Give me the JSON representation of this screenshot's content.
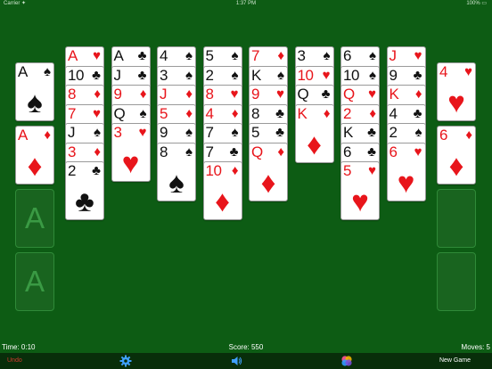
{
  "status_bar": {
    "carrier": "Carrier ✦",
    "clock": "1:37 PM",
    "battery": "100% ▭"
  },
  "colors": {
    "felt": "#0d5c14",
    "red_suit": "#e8151b",
    "black_suit": "#111111",
    "undo": "#d23a2e"
  },
  "free_cells": [
    {
      "rank": "A",
      "suit": "♠",
      "color": "black"
    },
    {
      "rank": "A",
      "suit": "♦",
      "color": "red"
    },
    {
      "empty": true,
      "glyph": "A"
    },
    {
      "empty": true,
      "glyph": "A"
    }
  ],
  "foundations": [
    {
      "rank": "4",
      "suit": "♥",
      "color": "red"
    },
    {
      "rank": "6",
      "suit": "♦",
      "color": "red"
    },
    {
      "empty": true
    },
    {
      "empty": true
    }
  ],
  "tableau": [
    [
      {
        "rank": "A",
        "suit": "♥",
        "color": "red"
      },
      {
        "rank": "10",
        "suit": "♣",
        "color": "black"
      },
      {
        "rank": "8",
        "suit": "♦",
        "color": "red"
      },
      {
        "rank": "7",
        "suit": "♥",
        "color": "red"
      },
      {
        "rank": "J",
        "suit": "♠",
        "color": "black"
      },
      {
        "rank": "3",
        "suit": "♦",
        "color": "red"
      },
      {
        "rank": "2",
        "suit": "♣",
        "color": "black"
      }
    ],
    [
      {
        "rank": "A",
        "suit": "♣",
        "color": "black"
      },
      {
        "rank": "J",
        "suit": "♣",
        "color": "black"
      },
      {
        "rank": "9",
        "suit": "♦",
        "color": "red"
      },
      {
        "rank": "Q",
        "suit": "♠",
        "color": "black"
      },
      {
        "rank": "3",
        "suit": "♥",
        "color": "red"
      }
    ],
    [
      {
        "rank": "4",
        "suit": "♠",
        "color": "black"
      },
      {
        "rank": "3",
        "suit": "♠",
        "color": "black"
      },
      {
        "rank": "J",
        "suit": "♦",
        "color": "red"
      },
      {
        "rank": "5",
        "suit": "♦",
        "color": "red"
      },
      {
        "rank": "9",
        "suit": "♠",
        "color": "black"
      },
      {
        "rank": "8",
        "suit": "♠",
        "color": "black"
      }
    ],
    [
      {
        "rank": "5",
        "suit": "♠",
        "color": "black"
      },
      {
        "rank": "2",
        "suit": "♠",
        "color": "black"
      },
      {
        "rank": "8",
        "suit": "♥",
        "color": "red"
      },
      {
        "rank": "4",
        "suit": "♦",
        "color": "red"
      },
      {
        "rank": "7",
        "suit": "♠",
        "color": "black"
      },
      {
        "rank": "7",
        "suit": "♣",
        "color": "black"
      },
      {
        "rank": "10",
        "suit": "♦",
        "color": "red"
      }
    ],
    [
      {
        "rank": "7",
        "suit": "♦",
        "color": "red"
      },
      {
        "rank": "K",
        "suit": "♠",
        "color": "black"
      },
      {
        "rank": "9",
        "suit": "♥",
        "color": "red"
      },
      {
        "rank": "8",
        "suit": "♣",
        "color": "black"
      },
      {
        "rank": "5",
        "suit": "♣",
        "color": "black"
      },
      {
        "rank": "Q",
        "suit": "♦",
        "color": "red"
      }
    ],
    [
      {
        "rank": "3",
        "suit": "♠",
        "color": "black"
      },
      {
        "rank": "10",
        "suit": "♥",
        "color": "red"
      },
      {
        "rank": "Q",
        "suit": "♣",
        "color": "black"
      },
      {
        "rank": "K",
        "suit": "♦",
        "color": "red"
      }
    ],
    [
      {
        "rank": "6",
        "suit": "♠",
        "color": "black"
      },
      {
        "rank": "10",
        "suit": "♠",
        "color": "black"
      },
      {
        "rank": "Q",
        "suit": "♥",
        "color": "red"
      },
      {
        "rank": "2",
        "suit": "♦",
        "color": "red"
      },
      {
        "rank": "K",
        "suit": "♣",
        "color": "black"
      },
      {
        "rank": "6",
        "suit": "♣",
        "color": "black"
      },
      {
        "rank": "5",
        "suit": "♥",
        "color": "red"
      }
    ],
    [
      {
        "rank": "J",
        "suit": "♥",
        "color": "red"
      },
      {
        "rank": "9",
        "suit": "♣",
        "color": "black"
      },
      {
        "rank": "K",
        "suit": "♦",
        "color": "red"
      },
      {
        "rank": "4",
        "suit": "♣",
        "color": "black"
      },
      {
        "rank": "2",
        "suit": "♠",
        "color": "black"
      },
      {
        "rank": "6",
        "suit": "♥",
        "color": "red"
      }
    ]
  ],
  "info_bar": {
    "time": "Time: 0:10",
    "score": "Score: 550",
    "moves": "Moves: 5"
  },
  "toolbar": {
    "undo": "Undo",
    "settings_icon": "gear-icon",
    "sound_icon": "speaker-icon",
    "game_center_icon": "game-center-icon",
    "new_game": "New Game"
  }
}
